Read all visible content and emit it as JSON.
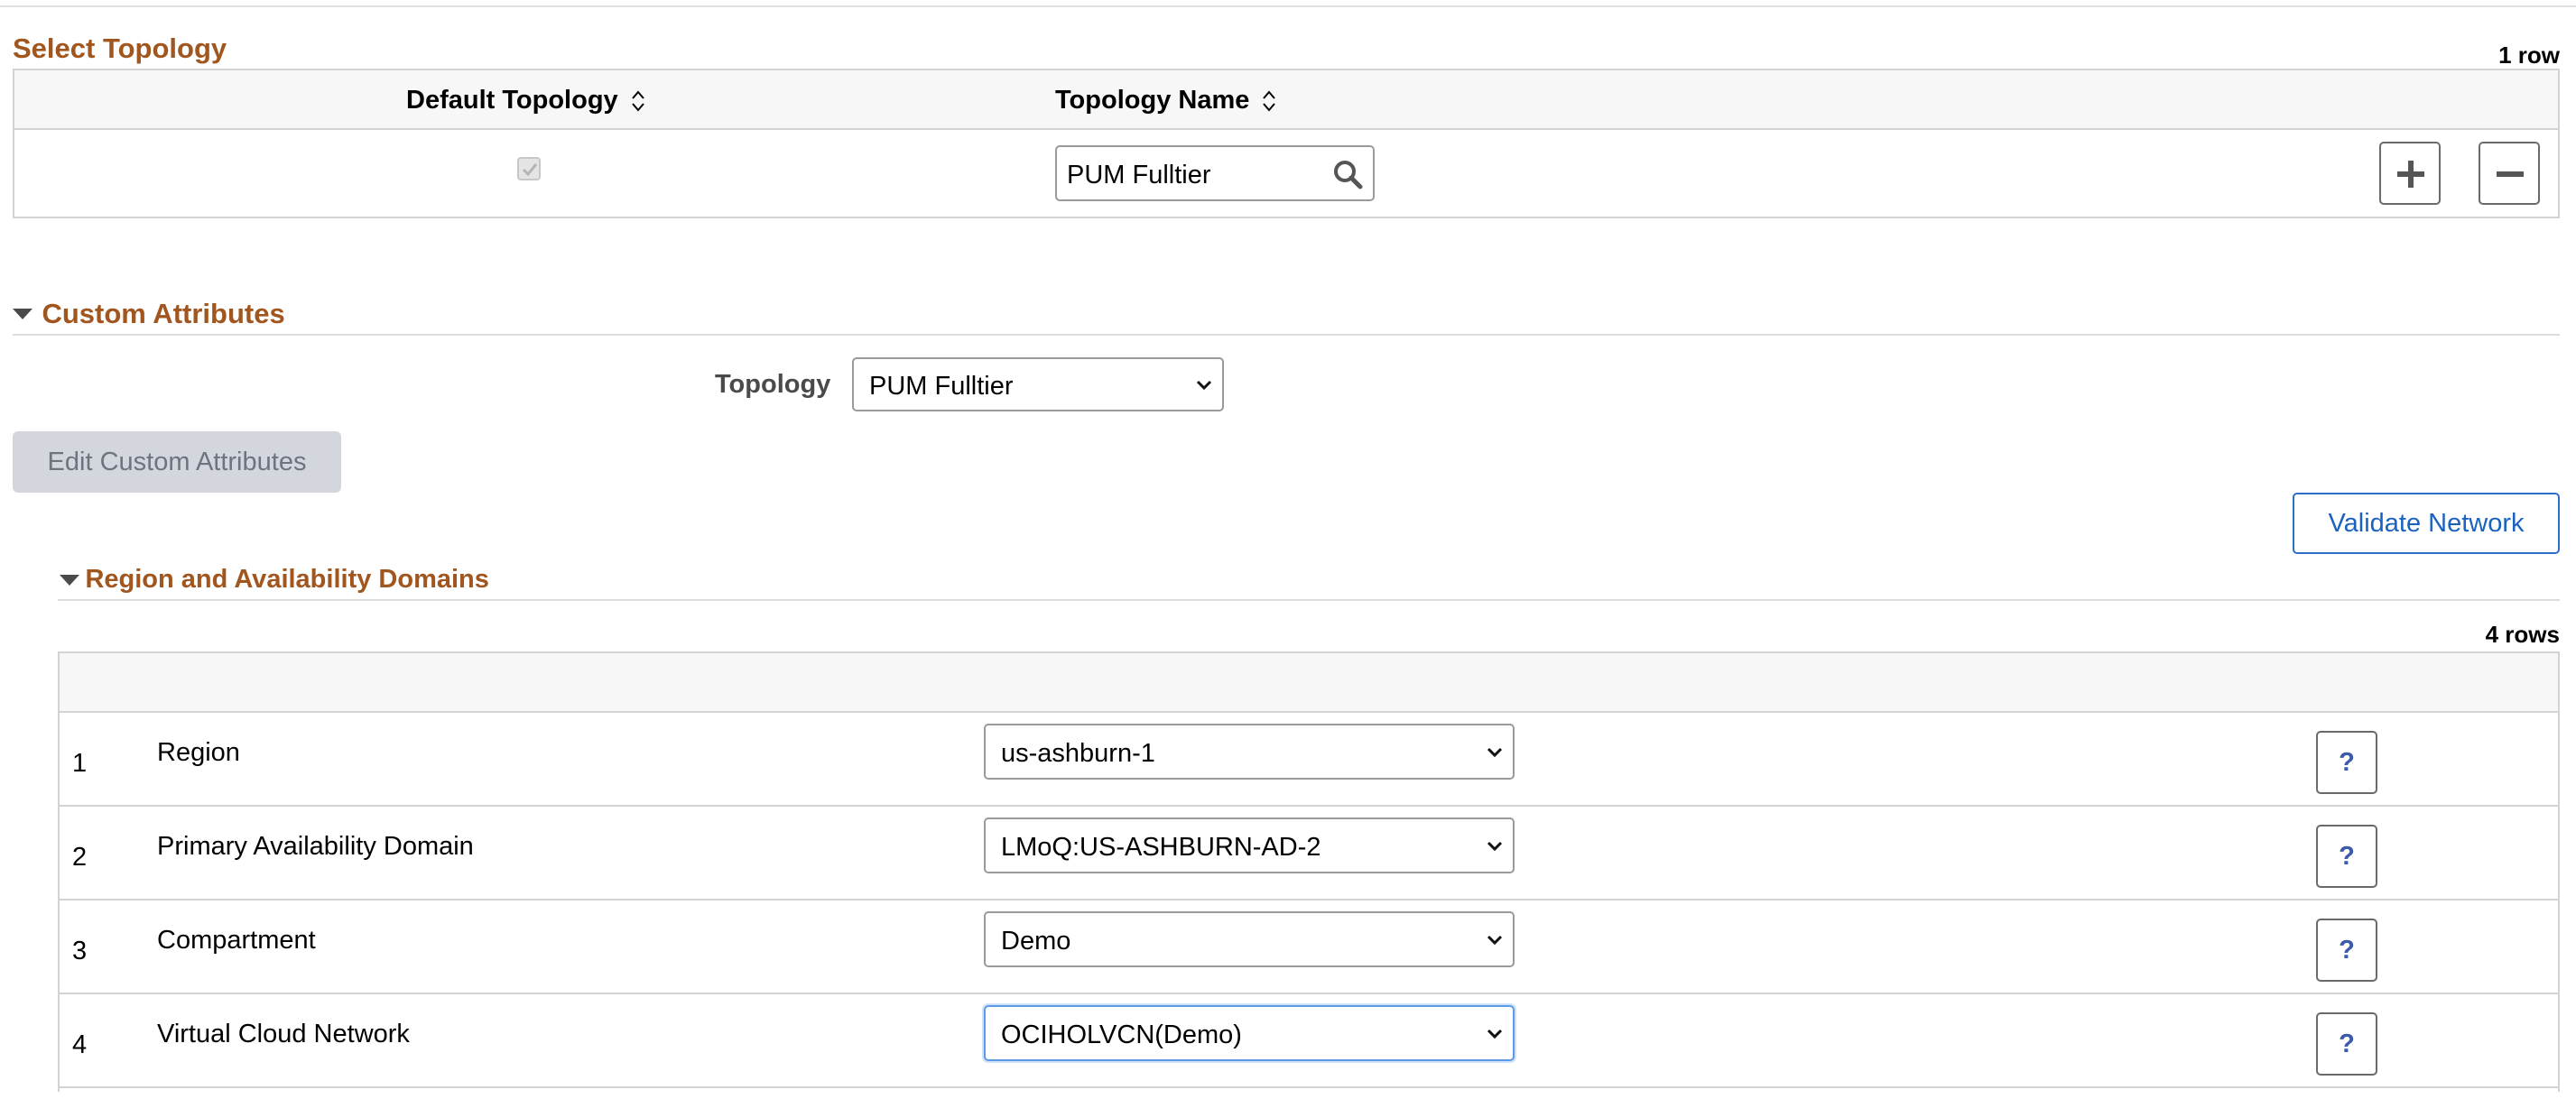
{
  "select_topology": {
    "title": "Select Topology",
    "row_count": "1 row",
    "columns": [
      "Default Topology",
      "Topology Name"
    ],
    "row": {
      "default_checked": true,
      "topology_name": "PUM Fulltier"
    }
  },
  "custom_attributes": {
    "title": "Custom Attributes",
    "topology_label": "Topology",
    "topology_value": "PUM Fulltier",
    "edit_button": "Edit Custom Attributes"
  },
  "validate_button": "Validate Network",
  "region_section": {
    "title": "Region and Availability Domains",
    "row_count": "4 rows",
    "rows": [
      {
        "num": "1",
        "label": "Region",
        "value": "us-ashburn-1",
        "help": "?"
      },
      {
        "num": "2",
        "label": "Primary Availability Domain",
        "value": "LMoQ:US-ASHBURN-AD-2",
        "help": "?"
      },
      {
        "num": "3",
        "label": "Compartment",
        "value": "Demo",
        "help": "?"
      },
      {
        "num": "4",
        "label": "Virtual Cloud Network",
        "value": "OCIHOLVCN(Demo)",
        "help": "?",
        "focused": true
      }
    ]
  },
  "colors": {
    "section_title": "#a0561e",
    "link_blue": "#1b62c0",
    "focus_border": "#5b9be6",
    "disabled_button_bg": "#d3d7dd"
  },
  "icons": {
    "sort": "sort-updown-icon",
    "lookup": "search-icon",
    "add": "plus-icon",
    "delete": "minus-icon",
    "select": "chevron-down-icon",
    "collapse": "caret-down-icon"
  }
}
